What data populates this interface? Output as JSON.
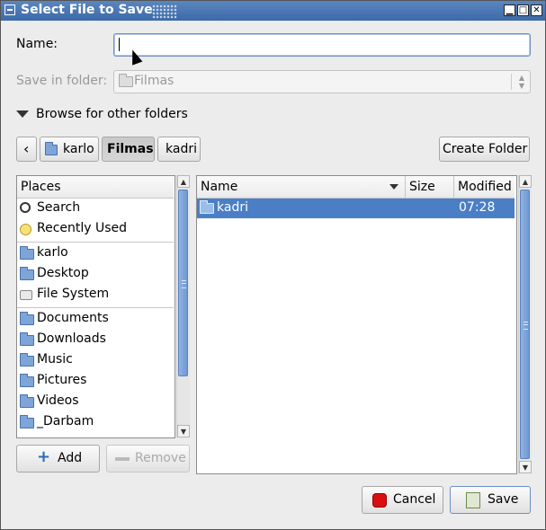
{
  "window": {
    "title": "Select File to Save"
  },
  "titlebar_buttons": [
    {
      "name": "minimize-button",
      "glyph": "▁"
    },
    {
      "name": "maximize-button",
      "glyph": "□"
    },
    {
      "name": "close-button",
      "glyph": "✕"
    }
  ],
  "form": {
    "name_label": "Name:",
    "name_value": "",
    "folder_label": "Save in folder:",
    "folder_value": "Filmas",
    "expander_label": "Browse for other folders"
  },
  "pathbar": {
    "back_glyph": "‹",
    "segments": [
      "karlo",
      "Filmas",
      "kadri"
    ],
    "active_segment": "Filmas",
    "create_folder_label": "Create Folder"
  },
  "places": {
    "header": "Places",
    "group1": [
      {
        "label": "Search",
        "icon": "search-icon"
      },
      {
        "label": "Recently Used",
        "icon": "recent-icon"
      }
    ],
    "group2": [
      {
        "label": "karlo",
        "icon": "home-folder-icon"
      },
      {
        "label": "Desktop",
        "icon": "desktop-folder-icon"
      },
      {
        "label": "File System",
        "icon": "filesystem-icon"
      }
    ],
    "group3": [
      {
        "label": "Documents",
        "icon": "documents-folder-icon"
      },
      {
        "label": "Downloads",
        "icon": "downloads-folder-icon"
      },
      {
        "label": "Music",
        "icon": "music-folder-icon"
      },
      {
        "label": "Pictures",
        "icon": "pictures-folder-icon"
      },
      {
        "label": "Videos",
        "icon": "videos-folder-icon"
      },
      {
        "label": "_Darbam",
        "icon": "folder-icon"
      }
    ],
    "add_label": "Add",
    "remove_label": "Remove"
  },
  "files": {
    "columns": [
      "Name",
      "Size",
      "Modified"
    ],
    "rows": [
      {
        "name": "kadri",
        "size": "",
        "modified": "07:28",
        "selected": true
      }
    ]
  },
  "actions": {
    "cancel_label": "Cancel",
    "save_label": "Save"
  },
  "colors": {
    "titlebar": "#3c6aa8",
    "selection": "#4a7fc6",
    "focus_border": "#6a8fc7"
  }
}
